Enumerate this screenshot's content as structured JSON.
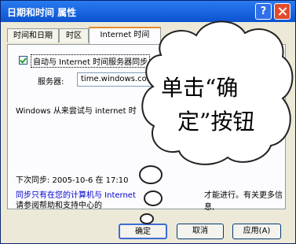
{
  "window": {
    "title": "日期和时间 属性",
    "help_label": "?"
  },
  "tabs": [
    {
      "label": "时间和日期"
    },
    {
      "label": "时区"
    },
    {
      "label": "Internet 时间"
    }
  ],
  "internet_time": {
    "sync_label": "自动与 Internet 时间服务器同步",
    "server_label": "服务器:",
    "server_value": "time.windows.com",
    "windows_msg": "Windows 从来尝试与 internet 时",
    "next_sync": "下次同步: 2005-10-6 在 17:10",
    "note_line1": "同步只有在您的计算机与 Internet",
    "note_line1_tail": "才能进行。有关更多信息,",
    "note_line2": "请参阅帮助和支持中心的"
  },
  "buttons": {
    "ok": "确定",
    "cancel": "取消",
    "apply": "应用(A)"
  },
  "callout": {
    "line1": "单击“确",
    "line2": "定”按钮"
  }
}
